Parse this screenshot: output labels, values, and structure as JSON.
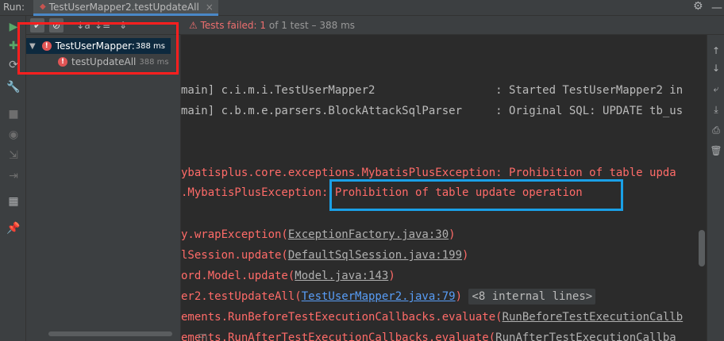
{
  "header": {
    "run_label": "Run:",
    "tab_title": "TestUserMapper2.testUpdateAll",
    "tab_icon": "test-config-icon",
    "gear_icon": "gear-icon",
    "minimize_icon": "minimize-icon"
  },
  "status": {
    "prefix": "Tests failed: ",
    "count": "1",
    "rest": " of 1 test – 388 ms"
  },
  "tree": {
    "root_label": "TestUserMapper:",
    "root_time": "388 ms",
    "child_label": "testUpdateAll",
    "child_time": "388 ms"
  },
  "console": {
    "line1": "main] c.i.m.i.TestUserMapper2                  : Started TestUserMapper2 in",
    "line2": "main] c.b.m.e.parsers.BlockAttackSqlParser     : Original SQL: UPDATE tb_us",
    "exc1": "ybatisplus.core.exceptions.MybatisPlusException: Prohibition of table upda",
    "exc2_prefix": ".MybatisPlusException",
    "exc2_msg": ": Prohibition of table update operation",
    "st1_prefix": "y.wrapException(",
    "st1_link": "ExceptionFactory.java:30",
    "st1_suffix": ")",
    "st2_prefix": "lSession.update(",
    "st2_link": "DefaultSqlSession.java:199",
    "st2_suffix": ")",
    "st3_prefix": "ord.Model.update(",
    "st3_link": "Model.java:143",
    "st3_suffix": ")",
    "st4_prefix": "er2.testUpdateAll(",
    "st4_link": "TestUserMapper2.java:79",
    "st4_suffix": ") ",
    "st4_fold": "<8 internal lines>",
    "st5_prefix": "ements.RunBeforeTestExecutionCallbacks.evaluate(",
    "st5_link": "RunBeforeTestExecutionCallb",
    "st6_prefix": "ements.RunAfterTestExecutionCallbacks.evaluate(",
    "st6_link": "RunAfterTestExecutionCallba"
  },
  "colors": {
    "accent": "#4a88c7",
    "error": "#ff6b68",
    "link_blue": "#589df6",
    "highlight_red": "#ff1f1f",
    "highlight_blue": "#1aa0e6"
  }
}
